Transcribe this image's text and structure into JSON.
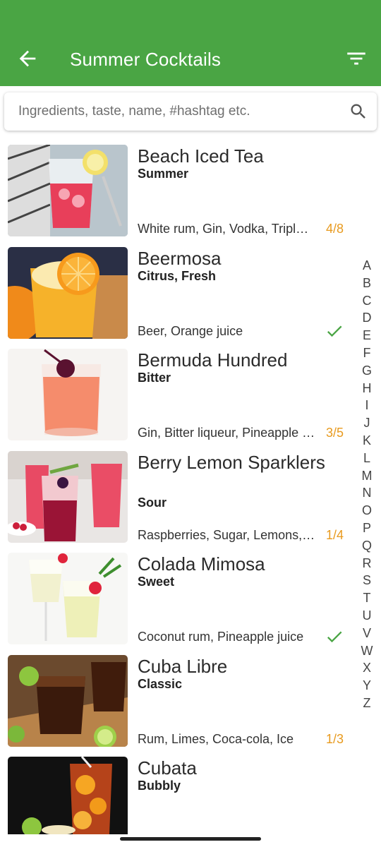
{
  "header": {
    "title": "Summer Cocktails",
    "back_icon": "arrow-left-icon",
    "filter_icon": "filter-icon",
    "color": "#4aa544"
  },
  "search": {
    "placeholder": "Ingredients, taste, name, #hashtag etc.",
    "value": "",
    "icon": "search-icon"
  },
  "cocktails": [
    {
      "name": "Beach Iced Tea",
      "tags": "Summer",
      "ingredients": "White rum, Gin, Vodka, Triple sec",
      "count": "4/8",
      "have_all": false
    },
    {
      "name": "Beermosa",
      "tags": "Citrus, Fresh",
      "ingredients": "Beer, Orange juice",
      "count": "",
      "have_all": true
    },
    {
      "name": "Bermuda Hundred",
      "tags": "Bitter",
      "ingredients": "Gin, Bitter liqueur, Pineapple juice",
      "count": "3/5",
      "have_all": false
    },
    {
      "name": "Berry Lemon Sparklers",
      "tags": "Sour",
      "ingredients": "Raspberries, Sugar, Lemons, Sparkling water",
      "count": "1/4",
      "have_all": false
    },
    {
      "name": "Colada Mimosa",
      "tags": "Sweet",
      "ingredients": "Coconut rum, Pineapple juice",
      "count": "",
      "have_all": true
    },
    {
      "name": "Cuba Libre",
      "tags": "Classic",
      "ingredients": "Rum, Limes, Coca-cola, Ice",
      "count": "1/3",
      "have_all": false
    },
    {
      "name": "Cubata",
      "tags": "Bubbly",
      "ingredients": "",
      "count": "",
      "have_all": false
    }
  ],
  "alphabet": [
    "A",
    "B",
    "C",
    "D",
    "E",
    "F",
    "G",
    "H",
    "I",
    "J",
    "K",
    "L",
    "M",
    "N",
    "O",
    "P",
    "Q",
    "R",
    "S",
    "T",
    "U",
    "V",
    "W",
    "X",
    "Y",
    "Z"
  ],
  "colors": {
    "count": "#e89a1e",
    "check": "#4aa544"
  }
}
